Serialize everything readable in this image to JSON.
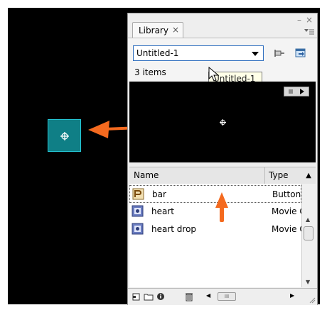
{
  "colors": {
    "stage": "#000000",
    "symbol_fill": "#0f7f86",
    "arrow": "#f46a1f",
    "accent": "#2f6fbf"
  },
  "panel": {
    "tab_label": "Library",
    "tab_close": "×",
    "window_minimize": "–",
    "window_close": "×",
    "library_select": {
      "value": "Untitled-1"
    },
    "tooltip": "Untitled-1",
    "item_count": "3 items",
    "columns": {
      "name": "Name",
      "type": "Type"
    },
    "items": [
      {
        "name": "bar",
        "type": "Button",
        "icon": "button-symbol-icon"
      },
      {
        "name": "heart",
        "type": "Movie Clip",
        "icon": "movieclip-symbol-icon"
      },
      {
        "name": "heart drop",
        "type": "Movie Clip",
        "icon": "movieclip-symbol-icon"
      }
    ],
    "hscroll_grip": "III"
  }
}
